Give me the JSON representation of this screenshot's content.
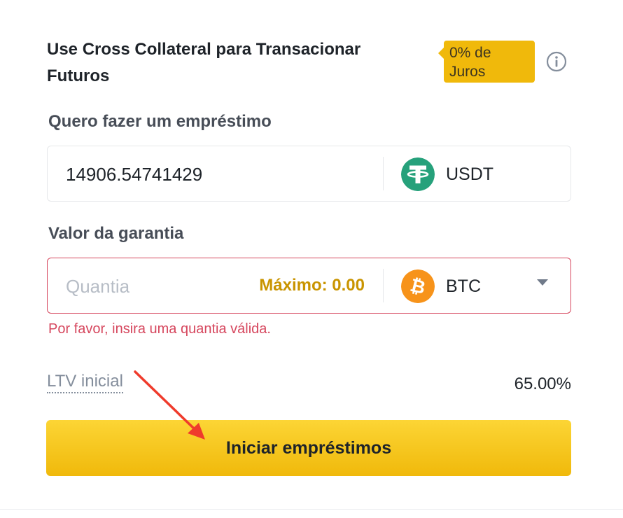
{
  "header": {
    "title": "Use Cross Collateral para Transacionar Futuros",
    "badge": "0% de Juros",
    "info_icon": "info-icon"
  },
  "borrow": {
    "label": "Quero fazer um empréstimo",
    "amount": "14906.54741429",
    "coin": "USDT",
    "coin_icon": "tether-icon",
    "coin_color": "#26a17b"
  },
  "collateral": {
    "label": "Valor da garantia",
    "placeholder": "Quantia",
    "max_label": "Máximo: 0.00",
    "coin": "BTC",
    "coin_icon": "bitcoin-icon",
    "coin_color": "#f7931a",
    "error": "Por favor, insira uma quantia válida."
  },
  "ltv": {
    "label": "LTV inicial",
    "value": "65.00%"
  },
  "actions": {
    "submit_label": "Iniciar empréstimos"
  },
  "colors": {
    "accent": "#f0b90b",
    "error": "#d6475e",
    "annotation_arrow": "#ef3b2c"
  }
}
